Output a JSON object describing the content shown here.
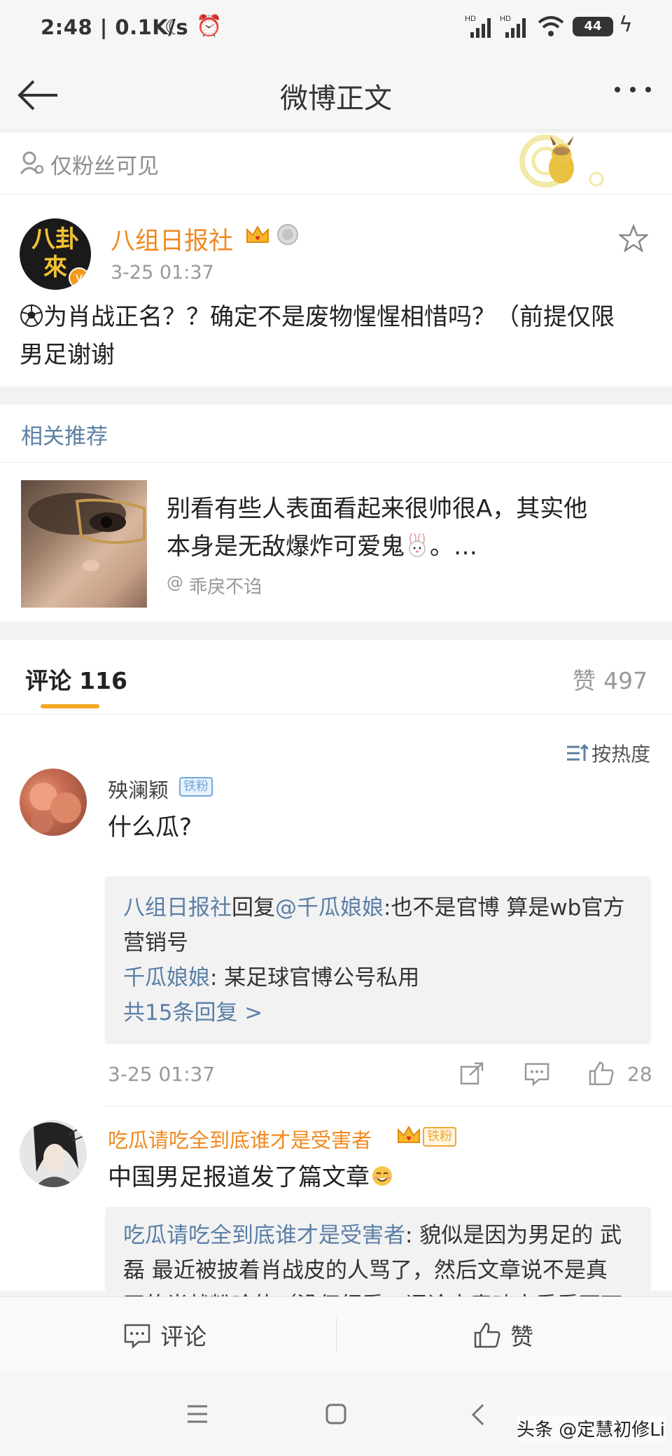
{
  "status_bar": {
    "time": "2:48 | 0.1K/s",
    "battery": "44",
    "net1": "HD",
    "net2": "HD"
  },
  "nav": {
    "title": "微博正文"
  },
  "visibility": {
    "text": "仅粉丝可见"
  },
  "post": {
    "author": "八组日报社",
    "avatar_text": "八卦來",
    "time": "3-25 01:37",
    "body_line1": "为肖战正名？？确定不是废物惺惺相惜吗？（前提仅限",
    "body_line2": "男足谢谢"
  },
  "related": {
    "header": "相关推荐",
    "title_line1": "别看有些人表面看起来很帅很A，其实他",
    "title_line2": "本身是无敌爆炸可爱鬼",
    "title_tail": "。…",
    "source": "乖戾不诌"
  },
  "tabs": {
    "comments_label": "评论",
    "comments_count": "116",
    "likes_label": "赞",
    "likes_count": "497"
  },
  "sort": {
    "label": "按热度"
  },
  "comments": [
    {
      "user": "殃澜颖",
      "badge": "铁粉",
      "text": "什么瓜?",
      "replies": [
        {
          "user": "八组日报社",
          "mid": "回复",
          "target": "@千瓜娘娘",
          "text": ":也不是官博 算是wb官方"
        },
        {
          "user": "",
          "mid": "",
          "target": "",
          "text": "营销号"
        },
        {
          "user": "千瓜娘娘",
          "mid": "",
          "target": "",
          "text": ": 某足球官博公号私用"
        }
      ],
      "more": "共15条回复 >",
      "time": "3-25 01:37",
      "likes": "28"
    },
    {
      "user": "吃瓜请吃全到底谁才是受害者",
      "badge": "铁粉",
      "text": "中国男足报道发了篇文章",
      "reply_user": "吃瓜请吃全到底谁才是受害者",
      "reply_line1": ": 貌似是因为男足的 武",
      "reply_line2": "磊 最近被披着肖战皮的人骂了，然后文章说不是真",
      "reply_line3": "正的肖战粉啥的（没仔细看，评论水竟味太重看不下"
    }
  ],
  "bottom_bar": {
    "comment": "评论",
    "like": "赞"
  },
  "watermark": {
    "text": "头条 @定慧初修Li"
  }
}
